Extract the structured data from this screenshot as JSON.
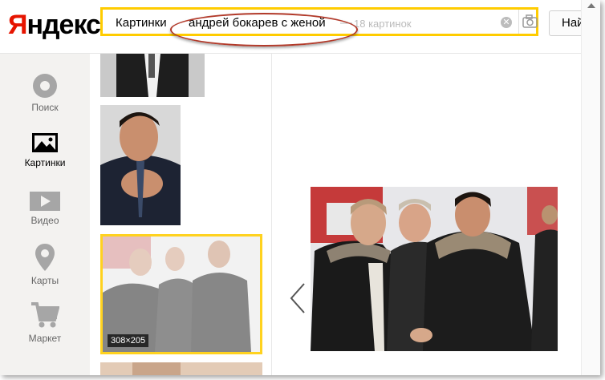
{
  "logo": {
    "first_letter": "Я",
    "rest": "ндекс"
  },
  "search": {
    "prefix": "Картинки",
    "query": "андрей бокарев с женой",
    "dash": "—",
    "hint": "18 картинок",
    "button_label": "Най"
  },
  "nav": {
    "items": [
      {
        "label": "Поиск",
        "icon": "search-icon"
      },
      {
        "label": "Картинки",
        "icon": "images-icon"
      },
      {
        "label": "Видео",
        "icon": "video-icon"
      },
      {
        "label": "Карты",
        "icon": "map-pin-icon"
      },
      {
        "label": "Маркет",
        "icon": "cart-icon"
      }
    ]
  },
  "thumbs": {
    "selected_size": "308×205"
  },
  "colors": {
    "accent_yellow": "#ffcc00",
    "logo_red": "#e61400",
    "annotation_oval": "#b23a2a"
  }
}
